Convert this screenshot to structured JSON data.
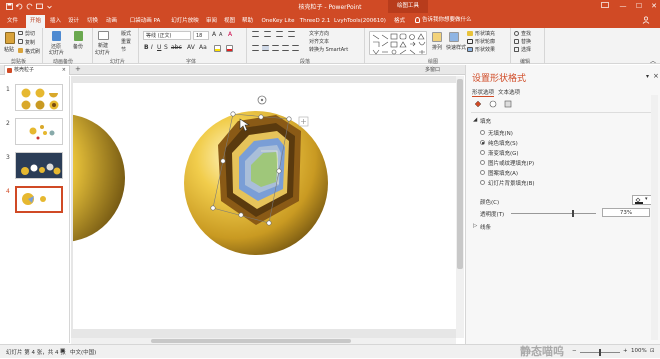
{
  "window": {
    "title": "核壳粒子 - PowerPoint",
    "contextual_tab_group": "绘图工具",
    "minimize": "—",
    "maximize": "☐",
    "close": "✕"
  },
  "tabs": [
    {
      "label": "文件"
    },
    {
      "label": "开始"
    },
    {
      "label": "插入"
    },
    {
      "label": "设计"
    },
    {
      "label": "切换"
    },
    {
      "label": "动画"
    },
    {
      "label": "口袋动画 PA"
    },
    {
      "label": "幻灯片放映"
    },
    {
      "label": "审阅"
    },
    {
      "label": "视图"
    },
    {
      "label": "帮助"
    },
    {
      "label": "OneKey Lite"
    },
    {
      "label": "ThreeD 2.1"
    },
    {
      "label": "LvyhTools(200610)"
    },
    {
      "label": "格式"
    }
  ],
  "tell_me": "告诉我你想要做什么",
  "ribbon": {
    "clipboard": {
      "paste": "粘贴",
      "cut": "剪切",
      "copy": "复制",
      "format_painter": "格式刷",
      "label": "剪贴板"
    },
    "animation_backup": {
      "restore": "还原",
      "backup": "备份",
      "slide_restore": "幻灯片",
      "label": "备份",
      "group_label": "动画备份"
    },
    "slides": {
      "new": "新建",
      "new2": "幻灯片",
      "layout": "版式",
      "reset": "重置",
      "section": "节",
      "label": "幻灯片"
    },
    "font": {
      "name": "等线 (正文)",
      "size": "18",
      "label": "字体"
    },
    "paragraph": {
      "text_direction": "文字方向",
      "align_text": "对齐文本",
      "smartart": "转换为 SmartArt",
      "label": "段落"
    },
    "drawing": {
      "arrange": "排列",
      "quick_styles": "快速样式",
      "shape_fill": "形状填充",
      "shape_outline": "形状轮廓",
      "shape_effects": "形状效果",
      "label": "绘图"
    },
    "editing": {
      "find": "查找",
      "replace": "替换",
      "select": "选择",
      "label": "编辑"
    }
  },
  "doc_tab": {
    "name": "核壳粒子",
    "close": "×",
    "add": "+",
    "window_label": "多窗口"
  },
  "slides": [
    {
      "number": "1"
    },
    {
      "number": "2"
    },
    {
      "number": "3"
    },
    {
      "number": "4"
    }
  ],
  "format_pane": {
    "title": "设置形状格式",
    "tab_shape": "形状选项",
    "tab_text": "文本选项",
    "fill_section": "填充",
    "fill_options": [
      {
        "label": "无填充(N)",
        "selected": false
      },
      {
        "label": "纯色填充(S)",
        "selected": true
      },
      {
        "label": "渐变填充(G)",
        "selected": false
      },
      {
        "label": "图片或纹理填充(P)",
        "selected": false
      },
      {
        "label": "图案填充(A)",
        "selected": false
      },
      {
        "label": "幻灯片背景填充(B)",
        "selected": false
      }
    ],
    "color_label": "颜色(C)",
    "transparency_label": "透明度(T)",
    "transparency_value": "73%",
    "transparency_fraction": 0.73,
    "line_section": "线条"
  },
  "status": {
    "slide_info": "幻灯片 第 4 张，共 4 张",
    "language": "中文(中国)",
    "zoom": "100%"
  },
  "watermark": "静态喵呜",
  "colors": {
    "accent": "#d04a25",
    "gold": "#e8c23a",
    "green": "#9fc77a",
    "blue": "#7a9ed6"
  }
}
